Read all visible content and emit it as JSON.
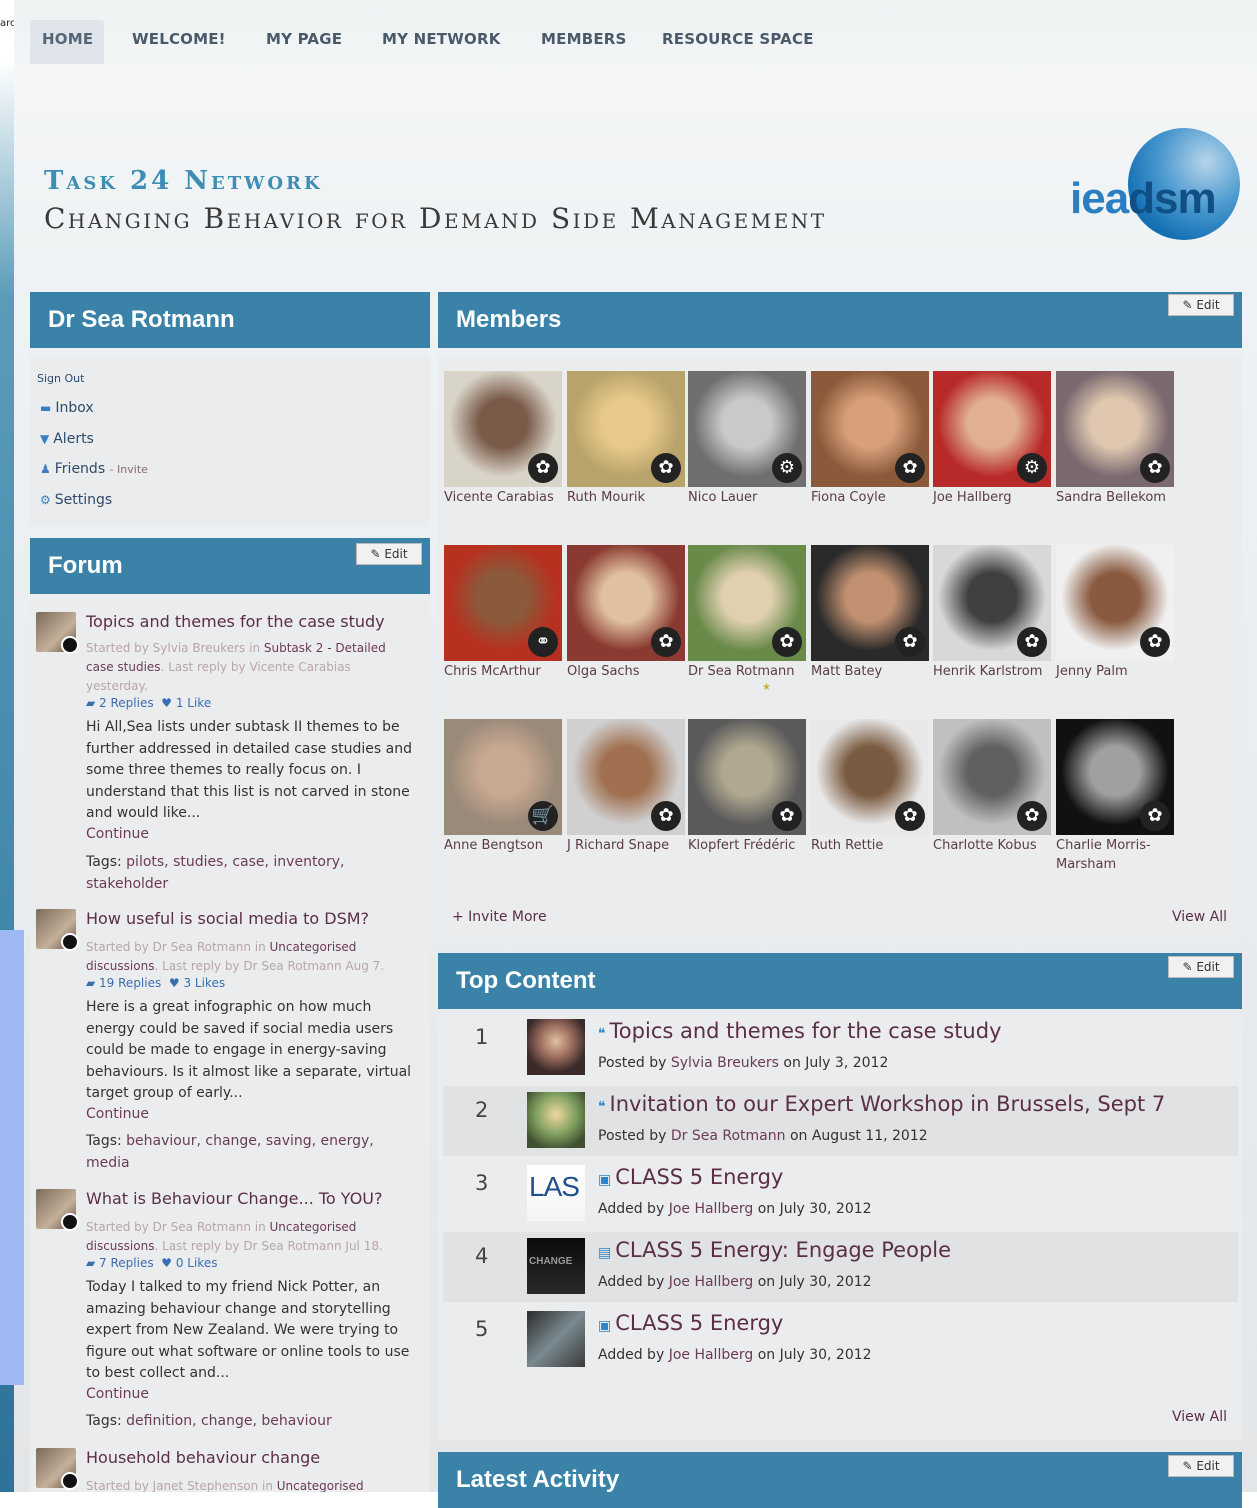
{
  "nav": {
    "cut_text": "arc",
    "items": [
      "HOME",
      "WELCOME!",
      "MY PAGE",
      "MY NETWORK",
      "MEMBERS",
      "RESOURCE SPACE"
    ]
  },
  "brand": {
    "line1": "Task 24 Network",
    "line2": "Changing Behavior for Demand Side Management",
    "logo_a": "iea",
    "logo_b": "dsm"
  },
  "profile": {
    "name": "Dr Sea Rotmann",
    "sign_out": "Sign Out",
    "inbox": "Inbox",
    "alerts": "Alerts",
    "friends": "Friends",
    "invite": "- Invite",
    "settings": "Settings"
  },
  "forum": {
    "title": "Forum",
    "edit": "Edit",
    "threads": [
      {
        "title": "Topics and themes for the case study",
        "meta_a": "Started by Sylvia Breukers in ",
        "meta_b": "Subtask 2 - Detailed case studies",
        "meta_c": ". Last reply by Vicente Carabias yesterday.",
        "replies": "2 Replies",
        "likes": "1 Like",
        "excerpt": "Hi All,Sea lists under subtask II themes to be further addressed in detailed case studies and some three themes to really focus on. I understand that this list is not carved in stone and would like...",
        "continue": "Continue",
        "tags_label": "Tags:",
        "tags": "pilots, studies, case, inventory, stakeholder"
      },
      {
        "title": "How useful is social media to DSM?",
        "meta_a": "Started by Dr Sea Rotmann in ",
        "meta_b": "Uncategorised discussions",
        "meta_c": ". Last reply by Dr Sea Rotmann Aug 7.",
        "replies": "19 Replies",
        "likes": "3 Likes",
        "excerpt": "Here is a great infographic on how much energy could be saved if social media users could be made to engage in energy-saving behaviours. Is it almost like a separate, virtual target group of early...",
        "continue": "Continue",
        "tags_label": "Tags:",
        "tags": "behaviour, change, saving, energy, media"
      },
      {
        "title": "What is Behaviour Change... To YOU?",
        "meta_a": "Started by Dr Sea Rotmann in ",
        "meta_b": "Uncategorised discussions",
        "meta_c": ". Last reply by Dr Sea Rotmann Jul 18.",
        "replies": "7 Replies",
        "likes": "0 Likes",
        "excerpt": "Today I talked to my friend Nick Potter, an amazing behaviour change and storytelling expert from New Zealand. We were trying to figure out what software or online tools to use to best collect and...",
        "continue": "Continue",
        "tags_label": "Tags:",
        "tags": "definition, change, behaviour"
      },
      {
        "title": "Household behaviour change",
        "meta_a": "Started by Janet Stephenson in ",
        "meta_b": "Uncategorised",
        "meta_c": ""
      }
    ]
  },
  "members": {
    "title": "Members",
    "edit": "Edit",
    "invite": "+ Invite More",
    "view_all": "View All",
    "people": [
      {
        "name": "Vicente Carabias",
        "badge": "✿",
        "c1": "#d9d4c8",
        "c2": "#7a5b4a"
      },
      {
        "name": "Ruth Mourik",
        "badge": "✿",
        "c1": "#b8a36a",
        "c2": "#e8c98a"
      },
      {
        "name": "Nico Lauer",
        "badge": "⚙",
        "c1": "#6f6f6f",
        "c2": "#c9c9c9"
      },
      {
        "name": "Fiona Coyle",
        "badge": "✿",
        "c1": "#8a5a3a",
        "c2": "#d8a07a"
      },
      {
        "name": "Joe Hallberg",
        "badge": "⚙",
        "c1": "#b82a2a",
        "c2": "#e0b090"
      },
      {
        "name": "Sandra Bellekom",
        "badge": "✿",
        "c1": "#7a6a70",
        "c2": "#e0c8b0"
      },
      {
        "name": "Chris McArthur",
        "badge": "⚭",
        "c1": "#b83020",
        "c2": "#8a5a3a"
      },
      {
        "name": "Olga Sachs",
        "badge": "✿",
        "c1": "#8a3a30",
        "c2": "#e0c0a0"
      },
      {
        "name": "Dr Sea Rotmann",
        "badge": "✿",
        "c1": "#6a8a4a",
        "c2": "#e0d0b0",
        "star": "★"
      },
      {
        "name": "Matt Batey",
        "badge": "✿",
        "c1": "#2a2a2a",
        "c2": "#c09070"
      },
      {
        "name": "Henrik Karlstrom",
        "badge": "✿",
        "c1": "#d8d8d8",
        "c2": "#404040"
      },
      {
        "name": "Jenny Palm",
        "badge": "✿",
        "c1": "#f0f0f0",
        "c2": "#8a5a40"
      },
      {
        "name": "Anne Bengtson",
        "badge": "🛒",
        "c1": "#9a8a7a",
        "c2": "#c8a890"
      },
      {
        "name": "J Richard Snape",
        "badge": "✿",
        "c1": "#d0d0d0",
        "c2": "#a07050"
      },
      {
        "name": "Klopfert Frédéric",
        "badge": "✿",
        "c1": "#5a5a5a",
        "c2": "#b0a890"
      },
      {
        "name": "Ruth Rettie",
        "badge": "✿",
        "c1": "#e8e8e8",
        "c2": "#7a5a40"
      },
      {
        "name": "Charlotte Kobus",
        "badge": "✿",
        "c1": "#c0c0c0",
        "c2": "#606060"
      },
      {
        "name": "Charlie Morris-Marsham",
        "badge": "✿",
        "c1": "#111111",
        "c2": "#a0a0a0"
      }
    ]
  },
  "top_content": {
    "title": "Top Content",
    "edit": "Edit",
    "view_all": "View All",
    "items": [
      {
        "rank": "1",
        "title": "Topics and themes for the case study",
        "prefix": "Posted by",
        "author": "Sylvia Breukers",
        "date": "on July 3, 2012",
        "icon": "forum-icon",
        "glyph": "❝"
      },
      {
        "rank": "2",
        "title": "Invitation to our Expert Workshop in Brussels, Sept 7",
        "prefix": "Posted by",
        "author": "Dr Sea Rotmann",
        "date": "on August 11, 2012",
        "icon": "forum-icon",
        "glyph": "❝"
      },
      {
        "rank": "3",
        "title": "CLASS 5 Energy",
        "prefix": "Added by",
        "author": "Joe Hallberg",
        "date": "on July 30, 2012",
        "icon": "photo-icon",
        "glyph": "▣",
        "thumb_text": "LAS"
      },
      {
        "rank": "4",
        "title": "CLASS 5 Energy: Engage People",
        "prefix": "Added by",
        "author": "Joe Hallberg",
        "date": "on July 30, 2012",
        "icon": "video-icon",
        "glyph": "▤",
        "thumb_text": "CHANGE"
      },
      {
        "rank": "5",
        "title": "CLASS 5 Energy",
        "prefix": "Added by",
        "author": "Joe Hallberg",
        "date": "on July 30, 2012",
        "icon": "photo-icon",
        "glyph": "▣"
      }
    ]
  },
  "latest_activity": {
    "title": "Latest Activity",
    "edit": "Edit"
  },
  "colors": {
    "panel_header": "#3a82a8",
    "link": "#5b2e46",
    "panel_body": "#ebecee"
  }
}
